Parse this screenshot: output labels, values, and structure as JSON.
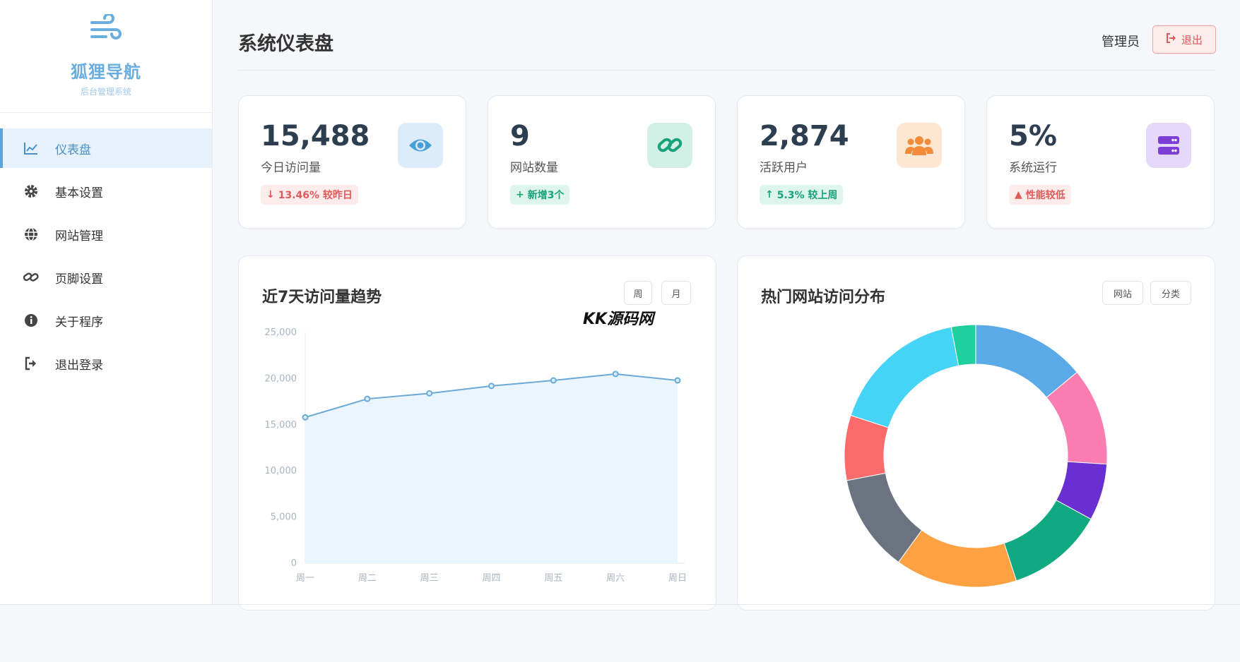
{
  "brand": {
    "name": "狐狸导航",
    "subtitle": "后台管理系统",
    "logo_icon": "wind-icon"
  },
  "sidebar": {
    "items": [
      {
        "label": "仪表盘",
        "icon": "chart-line-icon",
        "active": true
      },
      {
        "label": "基本设置",
        "icon": "gear-icon",
        "active": false
      },
      {
        "label": "网站管理",
        "icon": "globe-icon",
        "active": false
      },
      {
        "label": "页脚设置",
        "icon": "link-icon",
        "active": false
      },
      {
        "label": "关于程序",
        "icon": "info-icon",
        "active": false
      },
      {
        "label": "退出登录",
        "icon": "sign-out-icon",
        "active": false
      }
    ]
  },
  "header": {
    "title": "系统仪表盘",
    "user": "管理员",
    "logout_label": "退出"
  },
  "stats": [
    {
      "value": "15,488",
      "label": "今日访问量",
      "badge": "13.46% 较昨日",
      "badge_arrow": "↓",
      "badge_type": "danger",
      "icon": "eye-icon",
      "icon_color": "#4a9fd8",
      "icon_bg": "#dcecfa"
    },
    {
      "value": "9",
      "label": "网站数量",
      "badge": "新增3个",
      "badge_arrow": "+",
      "badge_type": "success",
      "icon": "link-icon",
      "icon_color": "#1aa37a",
      "icon_bg": "#d3f0e6"
    },
    {
      "value": "2,874",
      "label": "活跃用户",
      "badge": "5.3% 较上周",
      "badge_arrow": "↑",
      "badge_type": "success",
      "icon": "users-icon",
      "icon_color": "#f28c3a",
      "icon_bg": "#fde6d2"
    },
    {
      "value": "5%",
      "label": "系统运行",
      "badge": "性能较低",
      "badge_arrow": "▲",
      "badge_type": "danger",
      "icon": "server-icon",
      "icon_color": "#7b3fd6",
      "icon_bg": "#e6d8f8"
    }
  ],
  "trend_card": {
    "title": "近7天访问量趋势",
    "tabs": [
      "周",
      "月"
    ]
  },
  "dist_card": {
    "title": "热门网站访问分布",
    "tabs": [
      "网站",
      "分类"
    ]
  },
  "watermark": "KK源码网",
  "colors": {
    "accent": "#5aa3dd",
    "danger": "#e05a5a",
    "success": "#1aa37a"
  },
  "chart_data": [
    {
      "type": "area",
      "categories": [
        "周一",
        "周二",
        "周三",
        "周四",
        "周五",
        "周六",
        "周日"
      ],
      "series": [
        {
          "values": [
            15800,
            17800,
            18400,
            19200,
            19800,
            20500,
            19800
          ]
        }
      ],
      "ylim": [
        0,
        25000
      ],
      "yticks": [
        "0",
        "5,000",
        "10,000",
        "15,000",
        "20,000",
        "25,000"
      ],
      "line_color": "#6aa9d8",
      "fill_color": "#ebf5fd"
    },
    {
      "type": "pie",
      "donut": true,
      "slices": [
        {
          "value": 14,
          "color": "#5aaae8"
        },
        {
          "value": 12,
          "color": "#fb7db2"
        },
        {
          "value": 7,
          "color": "#6a2fd1"
        },
        {
          "value": 12,
          "color": "#10a982"
        },
        {
          "value": 15,
          "color": "#fda143"
        },
        {
          "value": 12,
          "color": "#6b7380"
        },
        {
          "value": 8,
          "color": "#fc6b6b"
        },
        {
          "value": 17,
          "color": "#46d4f6"
        },
        {
          "value": 3,
          "color": "#1fcf9e"
        }
      ]
    }
  ]
}
